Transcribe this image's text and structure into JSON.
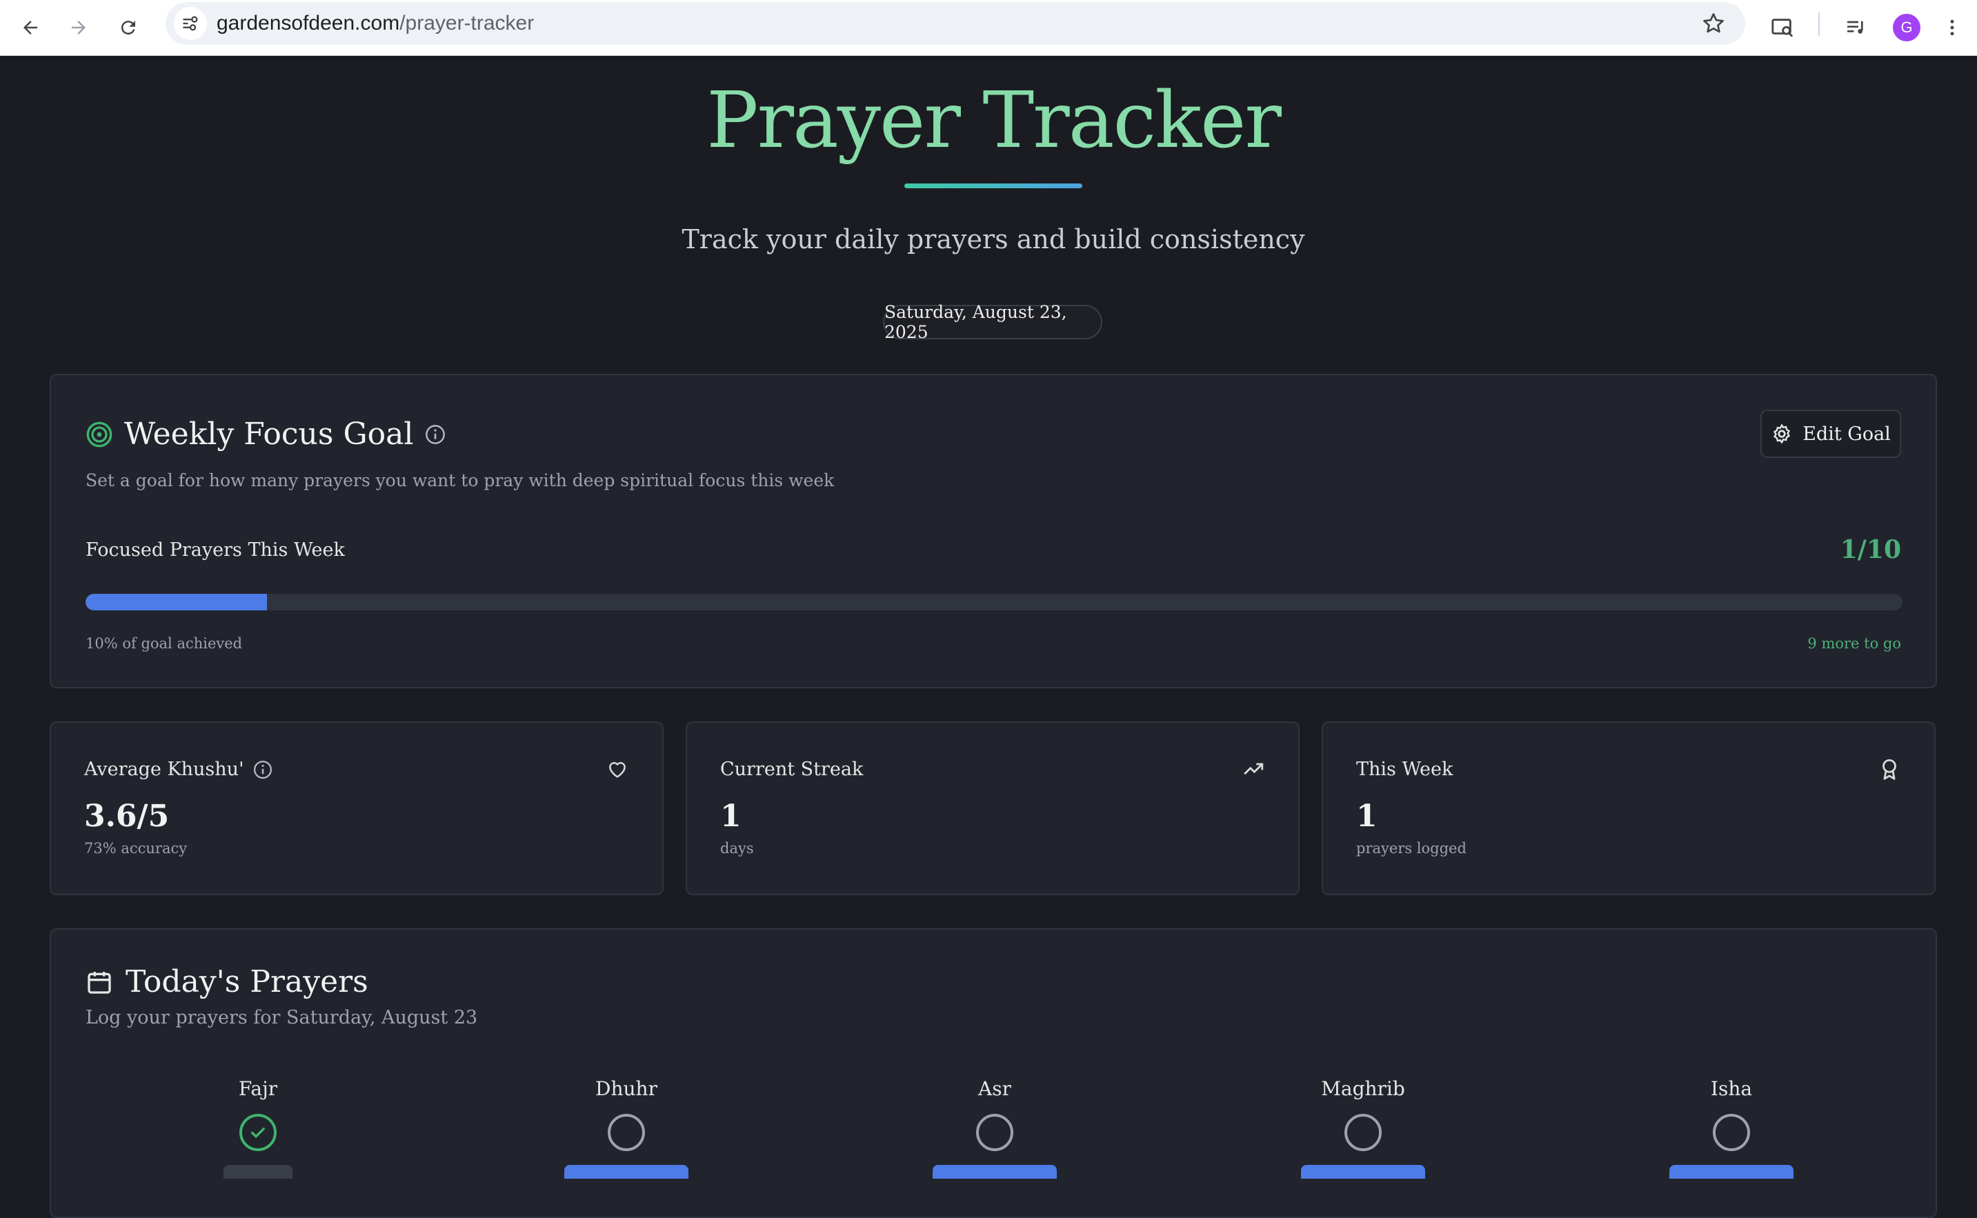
{
  "browser": {
    "url_domain": "gardensofdeen.com",
    "url_path": "/prayer-tracker",
    "profile_initial": "G",
    "icons": [
      "back-arrow-icon",
      "forward-arrow-icon",
      "reload-icon",
      "site-info-icon",
      "star-icon",
      "search-tab-icon",
      "media-queue-icon",
      "kebab-menu-icon"
    ]
  },
  "header": {
    "title": "Prayer Tracker",
    "subtitle": "Track your daily prayers and build consistency",
    "date": "Saturday, August 23, 2025"
  },
  "goal": {
    "title": "Weekly Focus Goal",
    "description": "Set a goal for how many prayers you want to pray with deep spiritual focus this week",
    "edit_label": "Edit Goal",
    "focused_label": "Focused Prayers This Week",
    "count": "1/10",
    "progress_fraction": 0.1,
    "progress_left": "10% of goal achieved",
    "progress_right": "9 more to go"
  },
  "stats": [
    {
      "label": "Average Khushu'",
      "value": "3.6/5",
      "sub": "73% accuracy",
      "icon": "heart-icon"
    },
    {
      "label": "Current Streak",
      "value": "1",
      "sub": "days",
      "icon": "trending-up-icon"
    },
    {
      "label": "This Week",
      "value": "1",
      "sub": "prayers logged",
      "icon": "award-icon"
    }
  ],
  "today": {
    "title": "Today's Prayers",
    "description": "Log your prayers for Saturday, August 23",
    "prayers": [
      {
        "name": "Fajr",
        "done": true
      },
      {
        "name": "Dhuhr",
        "done": false
      },
      {
        "name": "Asr",
        "done": false
      },
      {
        "name": "Maghrib",
        "done": false
      },
      {
        "name": "Isha",
        "done": false
      }
    ]
  },
  "colors": {
    "title_green": "#86dba8",
    "accent_green": "#4db07b",
    "progress_blue": "#4e7ce6",
    "background": "#1a1c21",
    "card": "#21242c"
  }
}
